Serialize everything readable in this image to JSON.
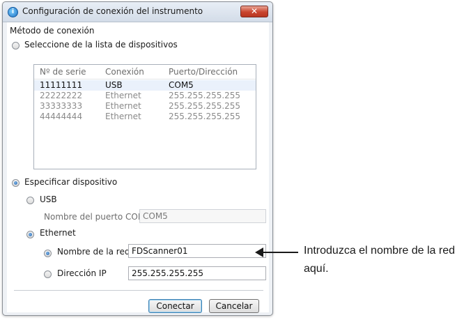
{
  "dialog": {
    "title": "Configuración de conexión del instrumento",
    "close_label": "✕"
  },
  "method": {
    "label": "Método de conexión",
    "from_list": {
      "label": "Seleccione de la lista de dispositivos",
      "selected": false
    },
    "table": {
      "headers": [
        "Nº de serie",
        "Conexión",
        "Puerto/Dirección"
      ],
      "rows": [
        {
          "serial": "11111111",
          "connection": "USB",
          "port": "COM5",
          "selected": true
        },
        {
          "serial": "22222222",
          "connection": "Ethernet",
          "port": "255.255.255.255",
          "selected": false
        },
        {
          "serial": "33333333",
          "connection": "Ethernet",
          "port": "255.255.255.255",
          "selected": false
        },
        {
          "serial": "44444444",
          "connection": "Ethernet",
          "port": "255.255.255.255",
          "selected": false
        }
      ]
    },
    "specify": {
      "label": "Especificar dispositivo",
      "selected": true
    },
    "usb": {
      "label": "USB",
      "selected": false,
      "com_label": "Nombre del puerto COM",
      "com_value": "COM5"
    },
    "ethernet": {
      "label": "Ethernet",
      "selected": true,
      "network_name": {
        "label": "Nombre de la red",
        "value": "FDScanner01",
        "selected": true
      },
      "ip": {
        "label": "Dirección IP",
        "value": "255.255.255.255",
        "selected": false
      }
    }
  },
  "buttons": {
    "connect": "Conectar",
    "cancel": "Cancelar"
  },
  "annotation": {
    "text": "Introduzca el nombre de la red aquí."
  }
}
